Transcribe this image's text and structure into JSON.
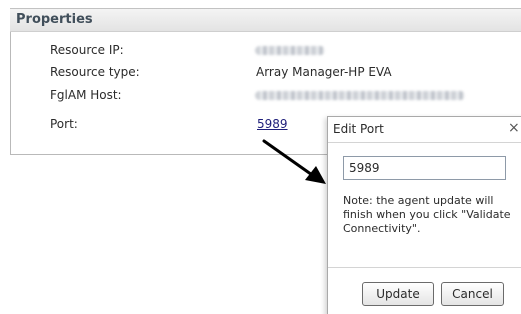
{
  "properties": {
    "header": "Properties",
    "rows": [
      {
        "label": "Resource IP:",
        "value": ""
      },
      {
        "label": "Resource type:",
        "value": "Array Manager-HP EVA"
      },
      {
        "label": "FglAM Host:",
        "value": ""
      },
      {
        "label": "Port:",
        "value": "5989"
      }
    ]
  },
  "dialog": {
    "title": "Edit Port",
    "close_glyph": "×",
    "port_value": "5989",
    "note": "Note: the agent update will finish when you click \"Validate Connectivity\".",
    "update_label": "Update",
    "cancel_label": "Cancel"
  }
}
